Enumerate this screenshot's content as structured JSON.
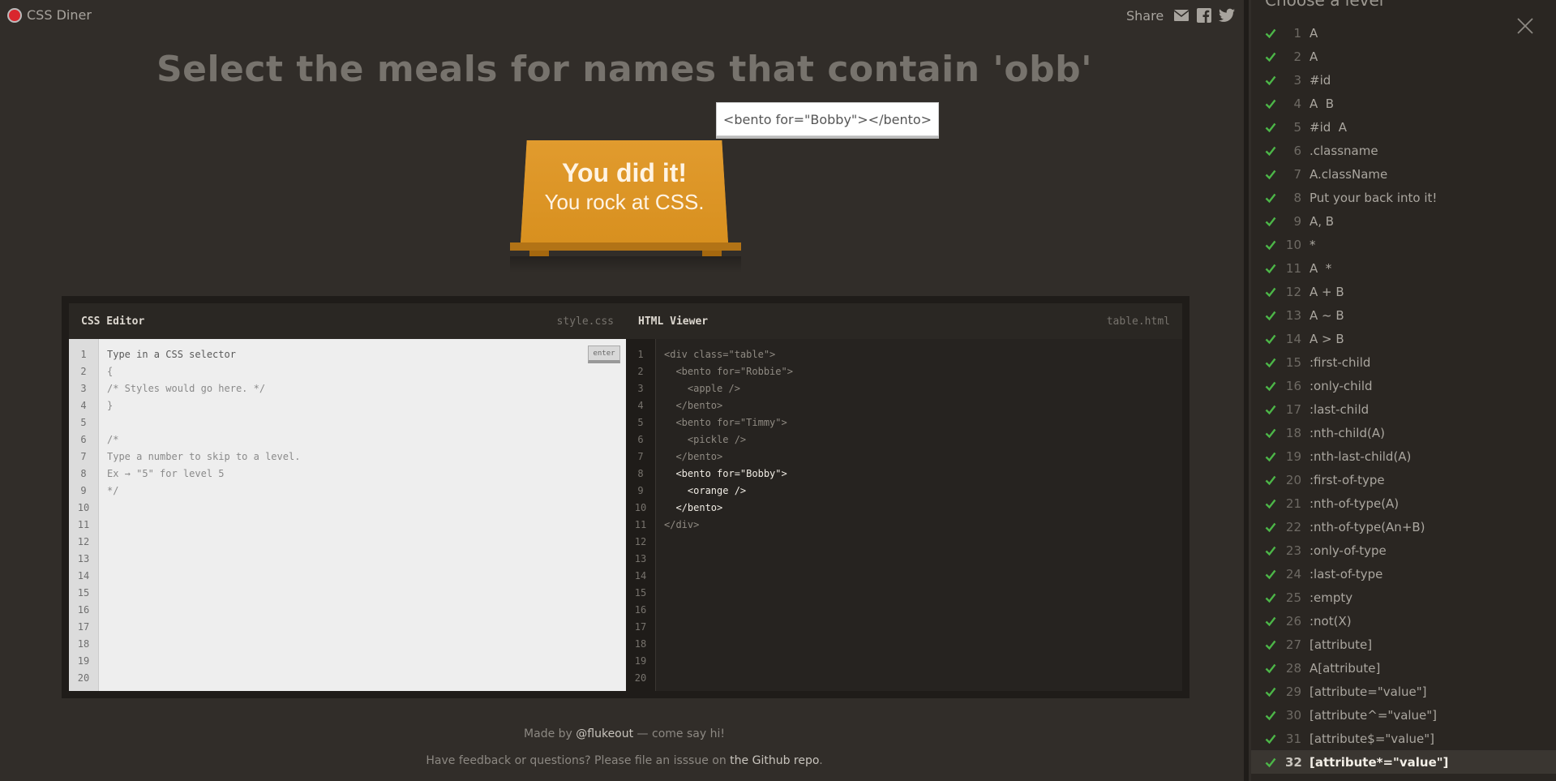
{
  "app": {
    "title": "CSS Diner"
  },
  "share": {
    "label": "Share",
    "icons": [
      "mail-icon",
      "facebook-icon",
      "twitter-icon"
    ]
  },
  "level": {
    "instruction": "Select the meals for names that contain 'obb'",
    "tooltip": "<bento for=\"Bobby\"></bento>",
    "win_line1": "You did it!",
    "win_line2": "You rock at CSS."
  },
  "css_editor": {
    "title": "CSS Editor",
    "file": "style.css",
    "enter_label": "enter",
    "line_numbers": [
      "1",
      "2",
      "3",
      "4",
      "5",
      "6",
      "7",
      "8",
      "9",
      "10",
      "11",
      "12",
      "13",
      "14",
      "15",
      "16",
      "17",
      "18",
      "19",
      "20"
    ],
    "lines": [
      "Type in a CSS selector",
      "{",
      "/* Styles would go here. */",
      "}",
      "",
      "/*",
      "Type a number to skip to a level.",
      "Ex → \"5\" for level 5",
      "*/"
    ]
  },
  "html_viewer": {
    "title": "HTML Viewer",
    "file": "table.html",
    "line_numbers": [
      "1",
      "2",
      "3",
      "4",
      "5",
      "6",
      "7",
      "8",
      "9",
      "10",
      "11",
      "12",
      "13",
      "14",
      "15",
      "16",
      "17",
      "18",
      "19",
      "20"
    ],
    "lines": [
      "<div class=\"table\">",
      "  <bento for=\"Robbie\">",
      "    <apple />",
      "  </bento>",
      "  <bento for=\"Timmy\">",
      "    <pickle />",
      "  </bento>",
      "  <bento for=\"Bobby\">",
      "    <orange />",
      "  </bento>",
      "</div>"
    ]
  },
  "footer": {
    "line1_prefix": "Made by ",
    "line1_link": "@flukeout",
    "line1_suffix": " — come say hi!",
    "line2_prefix": "Have feedback or questions? Please file an isssue on ",
    "line2_link": "the Github repo",
    "line2_suffix": "."
  },
  "sidebar": {
    "heading": "Choose a level",
    "close_icon": "close-icon",
    "check_color": "#4cb648",
    "current_level": 32,
    "levels": [
      {
        "num": "1",
        "label": "A"
      },
      {
        "num": "2",
        "label": "A"
      },
      {
        "num": "3",
        "label": "#id"
      },
      {
        "num": "4",
        "label": "A  B"
      },
      {
        "num": "5",
        "label": "#id  A"
      },
      {
        "num": "6",
        "label": ".classname"
      },
      {
        "num": "7",
        "label": "A.className"
      },
      {
        "num": "8",
        "label": "Put your back into it!"
      },
      {
        "num": "9",
        "label": "A, B"
      },
      {
        "num": "10",
        "label": "*"
      },
      {
        "num": "11",
        "label": "A  *"
      },
      {
        "num": "12",
        "label": "A + B"
      },
      {
        "num": "13",
        "label": "A ~ B"
      },
      {
        "num": "14",
        "label": "A > B"
      },
      {
        "num": "15",
        "label": ":first-child"
      },
      {
        "num": "16",
        "label": ":only-child"
      },
      {
        "num": "17",
        "label": ":last-child"
      },
      {
        "num": "18",
        "label": ":nth-child(A)"
      },
      {
        "num": "19",
        "label": ":nth-last-child(A)"
      },
      {
        "num": "20",
        "label": ":first-of-type"
      },
      {
        "num": "21",
        "label": ":nth-of-type(A)"
      },
      {
        "num": "22",
        "label": ":nth-of-type(An+B)"
      },
      {
        "num": "23",
        "label": ":only-of-type"
      },
      {
        "num": "24",
        "label": ":last-of-type"
      },
      {
        "num": "25",
        "label": ":empty"
      },
      {
        "num": "26",
        "label": ":not(X)"
      },
      {
        "num": "27",
        "label": "[attribute]"
      },
      {
        "num": "28",
        "label": "A[attribute]"
      },
      {
        "num": "29",
        "label": "[attribute=\"value\"]"
      },
      {
        "num": "30",
        "label": "[attribute^=\"value\"]"
      },
      {
        "num": "31",
        "label": "[attribute$=\"value\"]"
      },
      {
        "num": "32",
        "label": "[attribute*=\"value\"]"
      }
    ]
  }
}
